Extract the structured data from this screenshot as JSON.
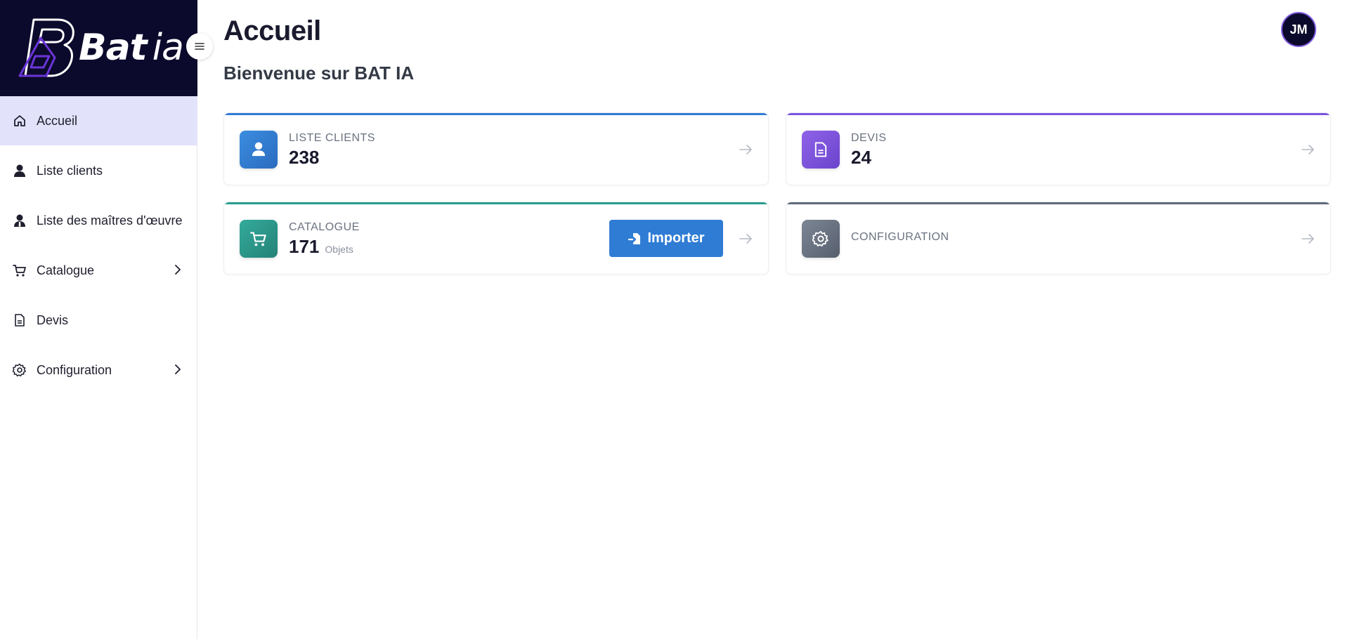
{
  "brand": {
    "name_bold": "Bat",
    "name_light": "ia"
  },
  "sidebar": {
    "items": [
      {
        "label": "Accueil",
        "icon": "home-icon",
        "active": true
      },
      {
        "label": "Liste clients",
        "icon": "user-icon"
      },
      {
        "label": "Liste des maîtres d'œuvre",
        "icon": "worker-icon"
      },
      {
        "label": "Catalogue",
        "icon": "cart-icon",
        "has_submenu": true
      },
      {
        "label": "Devis",
        "icon": "document-icon"
      },
      {
        "label": "Configuration",
        "icon": "gear-icon",
        "has_submenu": true
      }
    ]
  },
  "header": {
    "title": "Accueil",
    "subtitle": "Bienvenue sur BAT IA",
    "avatar_initials": "JM"
  },
  "cards": {
    "clients": {
      "label": "LISTE CLIENTS",
      "value": "238",
      "color": "#2f7cd4"
    },
    "devis": {
      "label": "DEVIS",
      "value": "24",
      "color": "#7a55e0"
    },
    "catalogue": {
      "label": "CATALOGUE",
      "value": "171",
      "unit": "Objets",
      "color": "#2a9d8f",
      "button_label": "Importer"
    },
    "configuration": {
      "label": "CONFIGURATION",
      "color": "#5f6b7a"
    }
  },
  "colors": {
    "sidebar_brand_bg": "#0c0a2c",
    "active_nav_bg": "#e2e2fa",
    "accent_blue": "#2f7cd4"
  }
}
